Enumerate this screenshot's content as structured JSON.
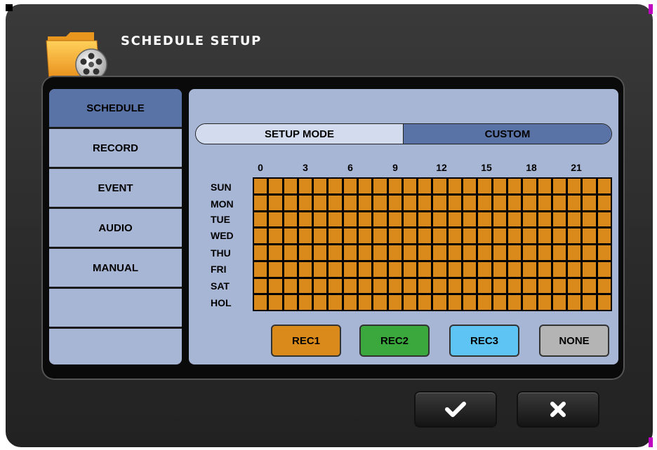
{
  "window": {
    "title": "SCHEDULE SETUP"
  },
  "sidebar": {
    "items": [
      {
        "label": "SCHEDULE",
        "active": true
      },
      {
        "label": "RECORD",
        "active": false
      },
      {
        "label": "EVENT",
        "active": false
      },
      {
        "label": "AUDIO",
        "active": false
      },
      {
        "label": "MANUAL",
        "active": false
      },
      {
        "label": "",
        "active": false
      },
      {
        "label": "",
        "active": false
      }
    ]
  },
  "mode": {
    "label": "SETUP MODE",
    "value": "CUSTOM"
  },
  "hours": [
    "0",
    "3",
    "6",
    "9",
    "12",
    "15",
    "18",
    "21"
  ],
  "days": [
    "SUN",
    "MON",
    "TUE",
    "WED",
    "THU",
    "FRI",
    "SAT",
    "HOL"
  ],
  "schedule": {
    "all_cells": "REC1"
  },
  "legend": [
    {
      "label": "REC1",
      "color": "#d98a1a"
    },
    {
      "label": "REC2",
      "color": "#3aa83c"
    },
    {
      "label": "REC3",
      "color": "#5ec4f4"
    },
    {
      "label": "NONE",
      "color": "#b4b4b4"
    }
  ],
  "footer": {
    "ok_icon": "checkmark-icon",
    "cancel_icon": "x-icon"
  }
}
